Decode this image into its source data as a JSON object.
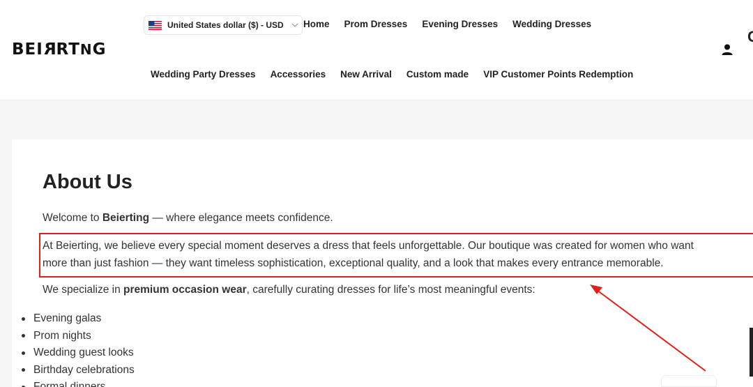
{
  "brand": {
    "logo_text": "BEIRTNG"
  },
  "currency": {
    "label": "United States dollar ($) - USD",
    "flag_icon": "us-flag-icon"
  },
  "nav": {
    "top": [
      "Home",
      "Prom Dresses",
      "Evening Dresses",
      "Wedding Dresses"
    ],
    "bottom": [
      "Wedding Party Dresses",
      "Accessories",
      "New Arrival",
      "Custom made",
      "VIP Customer Points Redemption"
    ]
  },
  "header_icons": {
    "account": "user-icon"
  },
  "content": {
    "title": "About Us",
    "p1_a": "Welcome to ",
    "p1_b": "Beierting",
    "p1_c": " — where elegance meets confidence.",
    "p2_line1": "At Beierting, we believe every special moment deserves a dress that feels unforgettable. Our boutique was created for women who want",
    "p2_line2": "more than just fashion — they want timeless sophistication, exceptional quality, and a look that makes every entrance memorable.",
    "p3_a": "We specialize in ",
    "p3_b": "premium occasion wear",
    "p3_c": ", carefully curating dresses for life’s most meaningful events:",
    "events": [
      "Evening galas",
      "Prom nights",
      "Wedding guest looks",
      "Birthday celebrations",
      "Formal dinners"
    ]
  },
  "annotation": {
    "color": "#e0201c"
  }
}
